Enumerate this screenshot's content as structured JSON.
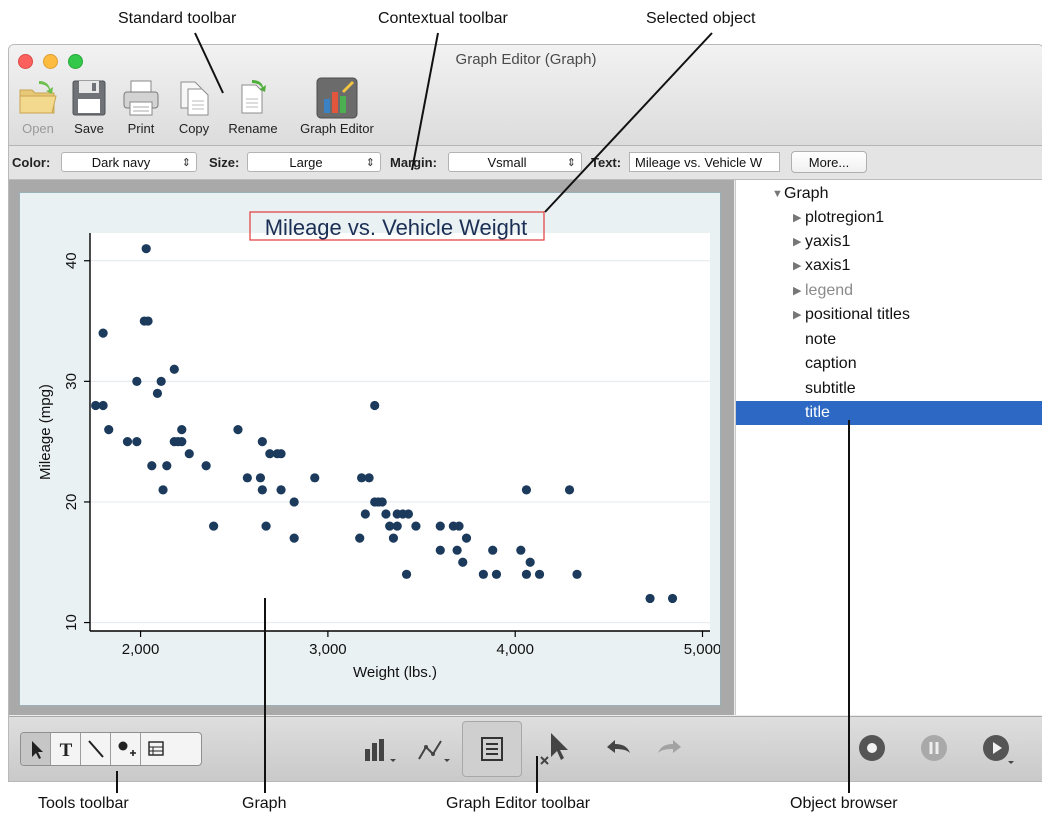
{
  "callouts": {
    "standard_toolbar": "Standard toolbar",
    "contextual_toolbar": "Contextual toolbar",
    "selected_object": "Selected object",
    "tools_toolbar": "Tools toolbar",
    "graph": "Graph",
    "graph_editor_toolbar": "Graph Editor toolbar",
    "object_browser": "Object browser"
  },
  "window": {
    "title": "Graph Editor (Graph)"
  },
  "toolbar": {
    "open": "Open",
    "save": "Save",
    "print": "Print",
    "copy": "Copy",
    "rename": "Rename",
    "graph_editor": "Graph Editor"
  },
  "contextual": {
    "color_label": "Color:",
    "color_value": "Dark navy",
    "size_label": "Size:",
    "size_value": "Large",
    "margin_label": "Margin:",
    "margin_value": "Vsmall",
    "text_label": "Text:",
    "text_value": "Mileage vs. Vehicle W",
    "more_button": "More..."
  },
  "object_browser": {
    "root": "Graph",
    "items": [
      "plotregion1",
      "yaxis1",
      "xaxis1",
      "legend",
      "positional titles",
      "note",
      "caption",
      "subtitle",
      "title"
    ]
  },
  "colors": {
    "point": "#1b3a5c",
    "selection": "#2d68c4",
    "title_box": "#e03a3a"
  },
  "icons": {
    "tools": [
      "arrow-pointer-icon",
      "text-tool-icon",
      "line-tool-icon",
      "marker-tool-icon",
      "grid-tool-icon"
    ],
    "graph_editor": [
      "add-plot-icon",
      "add-line-icon",
      "object-browser-icon",
      "deselect-icon",
      "undo-icon",
      "redo-icon"
    ],
    "recorder": [
      "record-icon",
      "pause-icon",
      "play-icon"
    ]
  },
  "chart_data": {
    "type": "scatter",
    "title": "Mileage vs. Vehicle Weight",
    "xlabel": "Weight (lbs.)",
    "ylabel": "Mileage (mpg)",
    "xlim": [
      1730,
      5040
    ],
    "ylim": [
      9.3,
      42.3
    ],
    "xticks": [
      2000,
      3000,
      4000,
      5000
    ],
    "xtick_labels": [
      "2,000",
      "3,000",
      "4,000",
      "5,000"
    ],
    "yticks": [
      10,
      20,
      30,
      40
    ],
    "ytick_labels": [
      "10",
      "20",
      "30",
      "40"
    ],
    "grid": true,
    "points": [
      [
        1760,
        28
      ],
      [
        1800,
        28
      ],
      [
        1800,
        34
      ],
      [
        1830,
        26
      ],
      [
        1930,
        25
      ],
      [
        1980,
        25
      ],
      [
        1980,
        30
      ],
      [
        2020,
        35
      ],
      [
        2030,
        41
      ],
      [
        2040,
        35
      ],
      [
        2060,
        23
      ],
      [
        2090,
        29
      ],
      [
        2110,
        30
      ],
      [
        2120,
        21
      ],
      [
        2140,
        23
      ],
      [
        2180,
        31
      ],
      [
        2180,
        25
      ],
      [
        2200,
        25
      ],
      [
        2220,
        26
      ],
      [
        2220,
        25
      ],
      [
        2260,
        24
      ],
      [
        2350,
        23
      ],
      [
        2390,
        18
      ],
      [
        2520,
        26
      ],
      [
        2570,
        22
      ],
      [
        2640,
        22
      ],
      [
        2650,
        21
      ],
      [
        2650,
        25
      ],
      [
        2670,
        18
      ],
      [
        2690,
        24
      ],
      [
        2730,
        24
      ],
      [
        2750,
        24
      ],
      [
        2750,
        21
      ],
      [
        2820,
        20
      ],
      [
        2820,
        17
      ],
      [
        2930,
        22
      ],
      [
        3170,
        17
      ],
      [
        3180,
        22
      ],
      [
        3200,
        19
      ],
      [
        3220,
        22
      ],
      [
        3250,
        28
      ],
      [
        3250,
        20
      ],
      [
        3270,
        20
      ],
      [
        3290,
        20
      ],
      [
        3310,
        19
      ],
      [
        3330,
        18
      ],
      [
        3350,
        17
      ],
      [
        3370,
        19
      ],
      [
        3370,
        18
      ],
      [
        3400,
        19
      ],
      [
        3420,
        14
      ],
      [
        3430,
        19
      ],
      [
        3470,
        18
      ],
      [
        3600,
        18
      ],
      [
        3600,
        16
      ],
      [
        3670,
        18
      ],
      [
        3690,
        16
      ],
      [
        3700,
        18
      ],
      [
        3720,
        15
      ],
      [
        3740,
        17
      ],
      [
        3830,
        14
      ],
      [
        3880,
        16
      ],
      [
        3900,
        14
      ],
      [
        4030,
        16
      ],
      [
        4060,
        14
      ],
      [
        4060,
        21
      ],
      [
        4080,
        15
      ],
      [
        4130,
        14
      ],
      [
        4290,
        21
      ],
      [
        4330,
        14
      ],
      [
        4720,
        12
      ],
      [
        4840,
        12
      ]
    ]
  }
}
